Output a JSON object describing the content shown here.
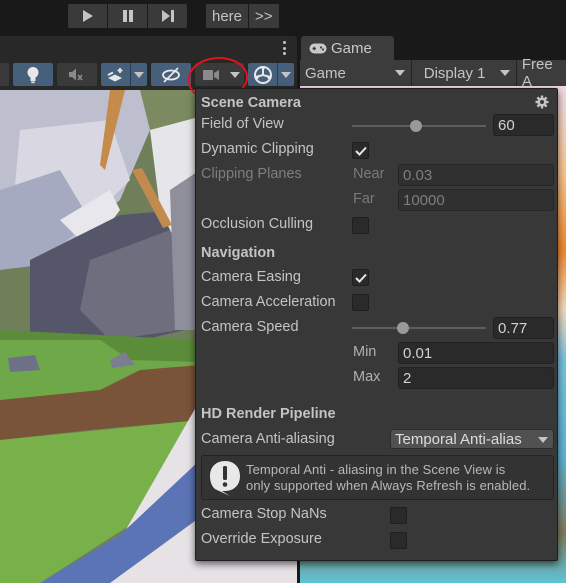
{
  "top_toolbar": {
    "play_icons": [
      "play-icon",
      "pause-icon",
      "step-icon"
    ],
    "here_label": "here",
    "more_label": ">>"
  },
  "scene_toolbar": {
    "buttons": [
      {
        "name": "lighting-toggle",
        "icon": "lightbulb-icon",
        "active": true
      },
      {
        "name": "audio-toggle",
        "icon": "audio-mute-icon",
        "active": false
      },
      {
        "name": "effects-toggle",
        "icon": "effects-icon",
        "active": true,
        "has_dropdown": true
      },
      {
        "name": "hidden-objects-toggle",
        "icon": "eye-slash-icon",
        "active": true
      },
      {
        "name": "scene-camera-button",
        "icon": "camera-icon",
        "active": false,
        "has_dropdown": true
      },
      {
        "name": "gizmos-toggle",
        "icon": "gizmo-icon",
        "active": true,
        "has_dropdown": true
      }
    ]
  },
  "game_panel": {
    "tab_label": "Game",
    "tab_icon": "gamepad-icon",
    "mode_dropdown": "Game",
    "display_dropdown": "Display 1",
    "aspect_dropdown": "Free A"
  },
  "scene_camera_popup": {
    "title": "Scene Camera",
    "settings_icon": "gear-icon",
    "field_of_view": {
      "label": "Field of View",
      "value": "60",
      "slider_fraction": 0.48
    },
    "dynamic_clipping": {
      "label": "Dynamic Clipping",
      "checked": true
    },
    "clipping_planes": {
      "label": "Clipping Planes",
      "near_label": "Near",
      "near_value": "0.03",
      "far_label": "Far",
      "far_value": "10000",
      "disabled": true
    },
    "occlusion_culling": {
      "label": "Occlusion Culling",
      "checked": false
    },
    "navigation": {
      "title": "Navigation",
      "camera_easing": {
        "label": "Camera Easing",
        "checked": true
      },
      "camera_acceleration": {
        "label": "Camera Acceleration",
        "checked": false
      },
      "camera_speed": {
        "label": "Camera Speed",
        "value": "0.77",
        "slider_fraction": 0.38,
        "min_label": "Min",
        "min_value": "0.01",
        "max_label": "Max",
        "max_value": "2"
      }
    },
    "hdrp": {
      "title": "HD Render Pipeline",
      "anti_aliasing": {
        "label": "Camera Anti-aliasing",
        "value": "Temporal Anti-alias"
      },
      "help_text_line1": "Temporal Anti - aliasing in the Scene View is",
      "help_text_line2": "only supported when Always Refresh is enabled.",
      "help_icon": "warning-speech-icon",
      "stop_nans": {
        "label": "Camera Stop NaNs",
        "checked": false
      },
      "override_exposure": {
        "label": "Override Exposure",
        "checked": false
      }
    }
  },
  "colors": {
    "active_button": "#46607c",
    "popup_bg": "#383838",
    "annotation_red": "#e0141c"
  }
}
